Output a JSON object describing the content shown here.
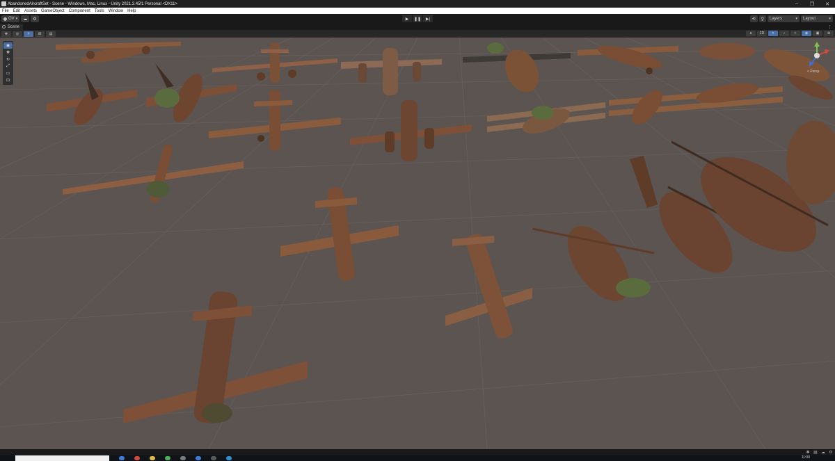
{
  "window": {
    "title": "AbandonedAircraftSet - Scene - Windows, Mac, Linux - Unity 2021.3.45f1 Personal <DX11>",
    "minimize_glyph": "–",
    "maximize_glyph": "❐",
    "close_glyph": "✕"
  },
  "menu": [
    "File",
    "Edit",
    "Assets",
    "GameObject",
    "Component",
    "Tools",
    "Window",
    "Help"
  ],
  "toolbar": {
    "account_label": "OV",
    "account_icon": "account-icon",
    "cloud_icon": "cloud-icon",
    "collab_icon": "collab-icon",
    "play_glyph": "▶",
    "pause_glyph": "❚❚",
    "step_glyph": "▶|",
    "layers_label": "Layers",
    "layout_label": "Layout",
    "history_icon": "history-icon",
    "search_icon": "search-icon"
  },
  "scene_tab": {
    "label": "Scene",
    "kebab": "⋮"
  },
  "scene_overlay_tools": [
    "view-tool",
    "move-tool",
    "rotate-tool",
    "scale-tool",
    "rect-tool",
    "transform-tool"
  ],
  "gizmo": {
    "projection_label": "< Persp"
  },
  "taskbar": {
    "clock": "11:00"
  },
  "colors": {
    "viewport_bg": "#5b5451",
    "toolbar_bg": "#191919",
    "accent": "#4a6fa5",
    "aircraft_rust": "#8a5a3c",
    "aircraft_shadow": "#4e3322",
    "foliage": "#5a6b3e"
  }
}
